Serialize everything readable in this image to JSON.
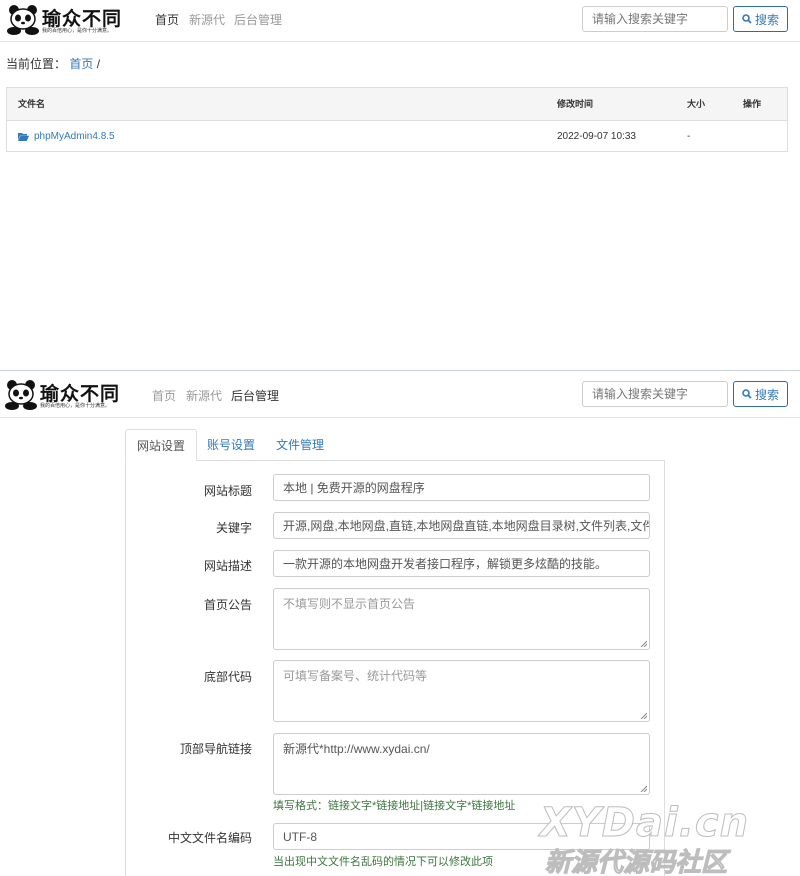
{
  "browse": {
    "logo": {
      "title": "瑜众不同",
      "slogan": "我的百倍用心，是你十分满意。"
    },
    "nav": [
      {
        "label": "首页"
      },
      {
        "label": "新源代"
      },
      {
        "label": "后台管理"
      }
    ],
    "search": {
      "placeholder": "请输入搜索关键字",
      "button_label": "搜索"
    },
    "breadcrumb": {
      "prefix": "当前位置：",
      "home": "首页",
      "separator": "/"
    },
    "table": {
      "headers": {
        "name": "文件名",
        "time": "修改时间",
        "size": "大小",
        "actions": "操作"
      },
      "rows": [
        {
          "name": "phpMyAdmin4.8.5",
          "time": "2022-09-07 10:33",
          "size": "-"
        }
      ]
    }
  },
  "admin": {
    "logo": {
      "title": "瑜众不同",
      "slogan": "我的百倍用心，是你十分满意。"
    },
    "nav": [
      {
        "label": "首页"
      },
      {
        "label": "新源代"
      },
      {
        "label": "后台管理"
      }
    ],
    "search": {
      "placeholder": "请输入搜索关键字",
      "button_label": "搜索"
    },
    "tabs": [
      {
        "label": "网站设置"
      },
      {
        "label": "账号设置"
      },
      {
        "label": "文件管理"
      }
    ],
    "form": {
      "site_title": {
        "label": "网站标题",
        "value": "本地 | 免费开源的网盘程序"
      },
      "keywords": {
        "label": "关键字",
        "value": "开源,网盘,本地网盘,直链,本地网盘直链,本地网盘目录树,文件列表,文件搜"
      },
      "description": {
        "label": "网站描述",
        "value": "一款开源的本地网盘开发者接口程序，解锁更多炫酷的技能。"
      },
      "notice": {
        "label": "首页公告",
        "placeholder": "不填写则不显示首页公告"
      },
      "footer_code": {
        "label": "底部代码",
        "placeholder": "可填写备案号、统计代码等"
      },
      "top_nav_links": {
        "label": "顶部导航链接",
        "value": "新源代*http://www.xydai.cn/",
        "help": "填写格式：链接文字*链接地址|链接文字*链接地址"
      },
      "cn_filename_encoding": {
        "label": "中文文件名编码",
        "value": "UTF-8",
        "help": "当出现中文文件名乱码的情况下可以修改此项"
      }
    }
  },
  "watermark": {
    "main": "XYDai.cn",
    "sub": "新源代源码社区"
  },
  "colors": {
    "link": "#337ab7",
    "help_text": "#3c763d",
    "border": "#dddddd"
  }
}
